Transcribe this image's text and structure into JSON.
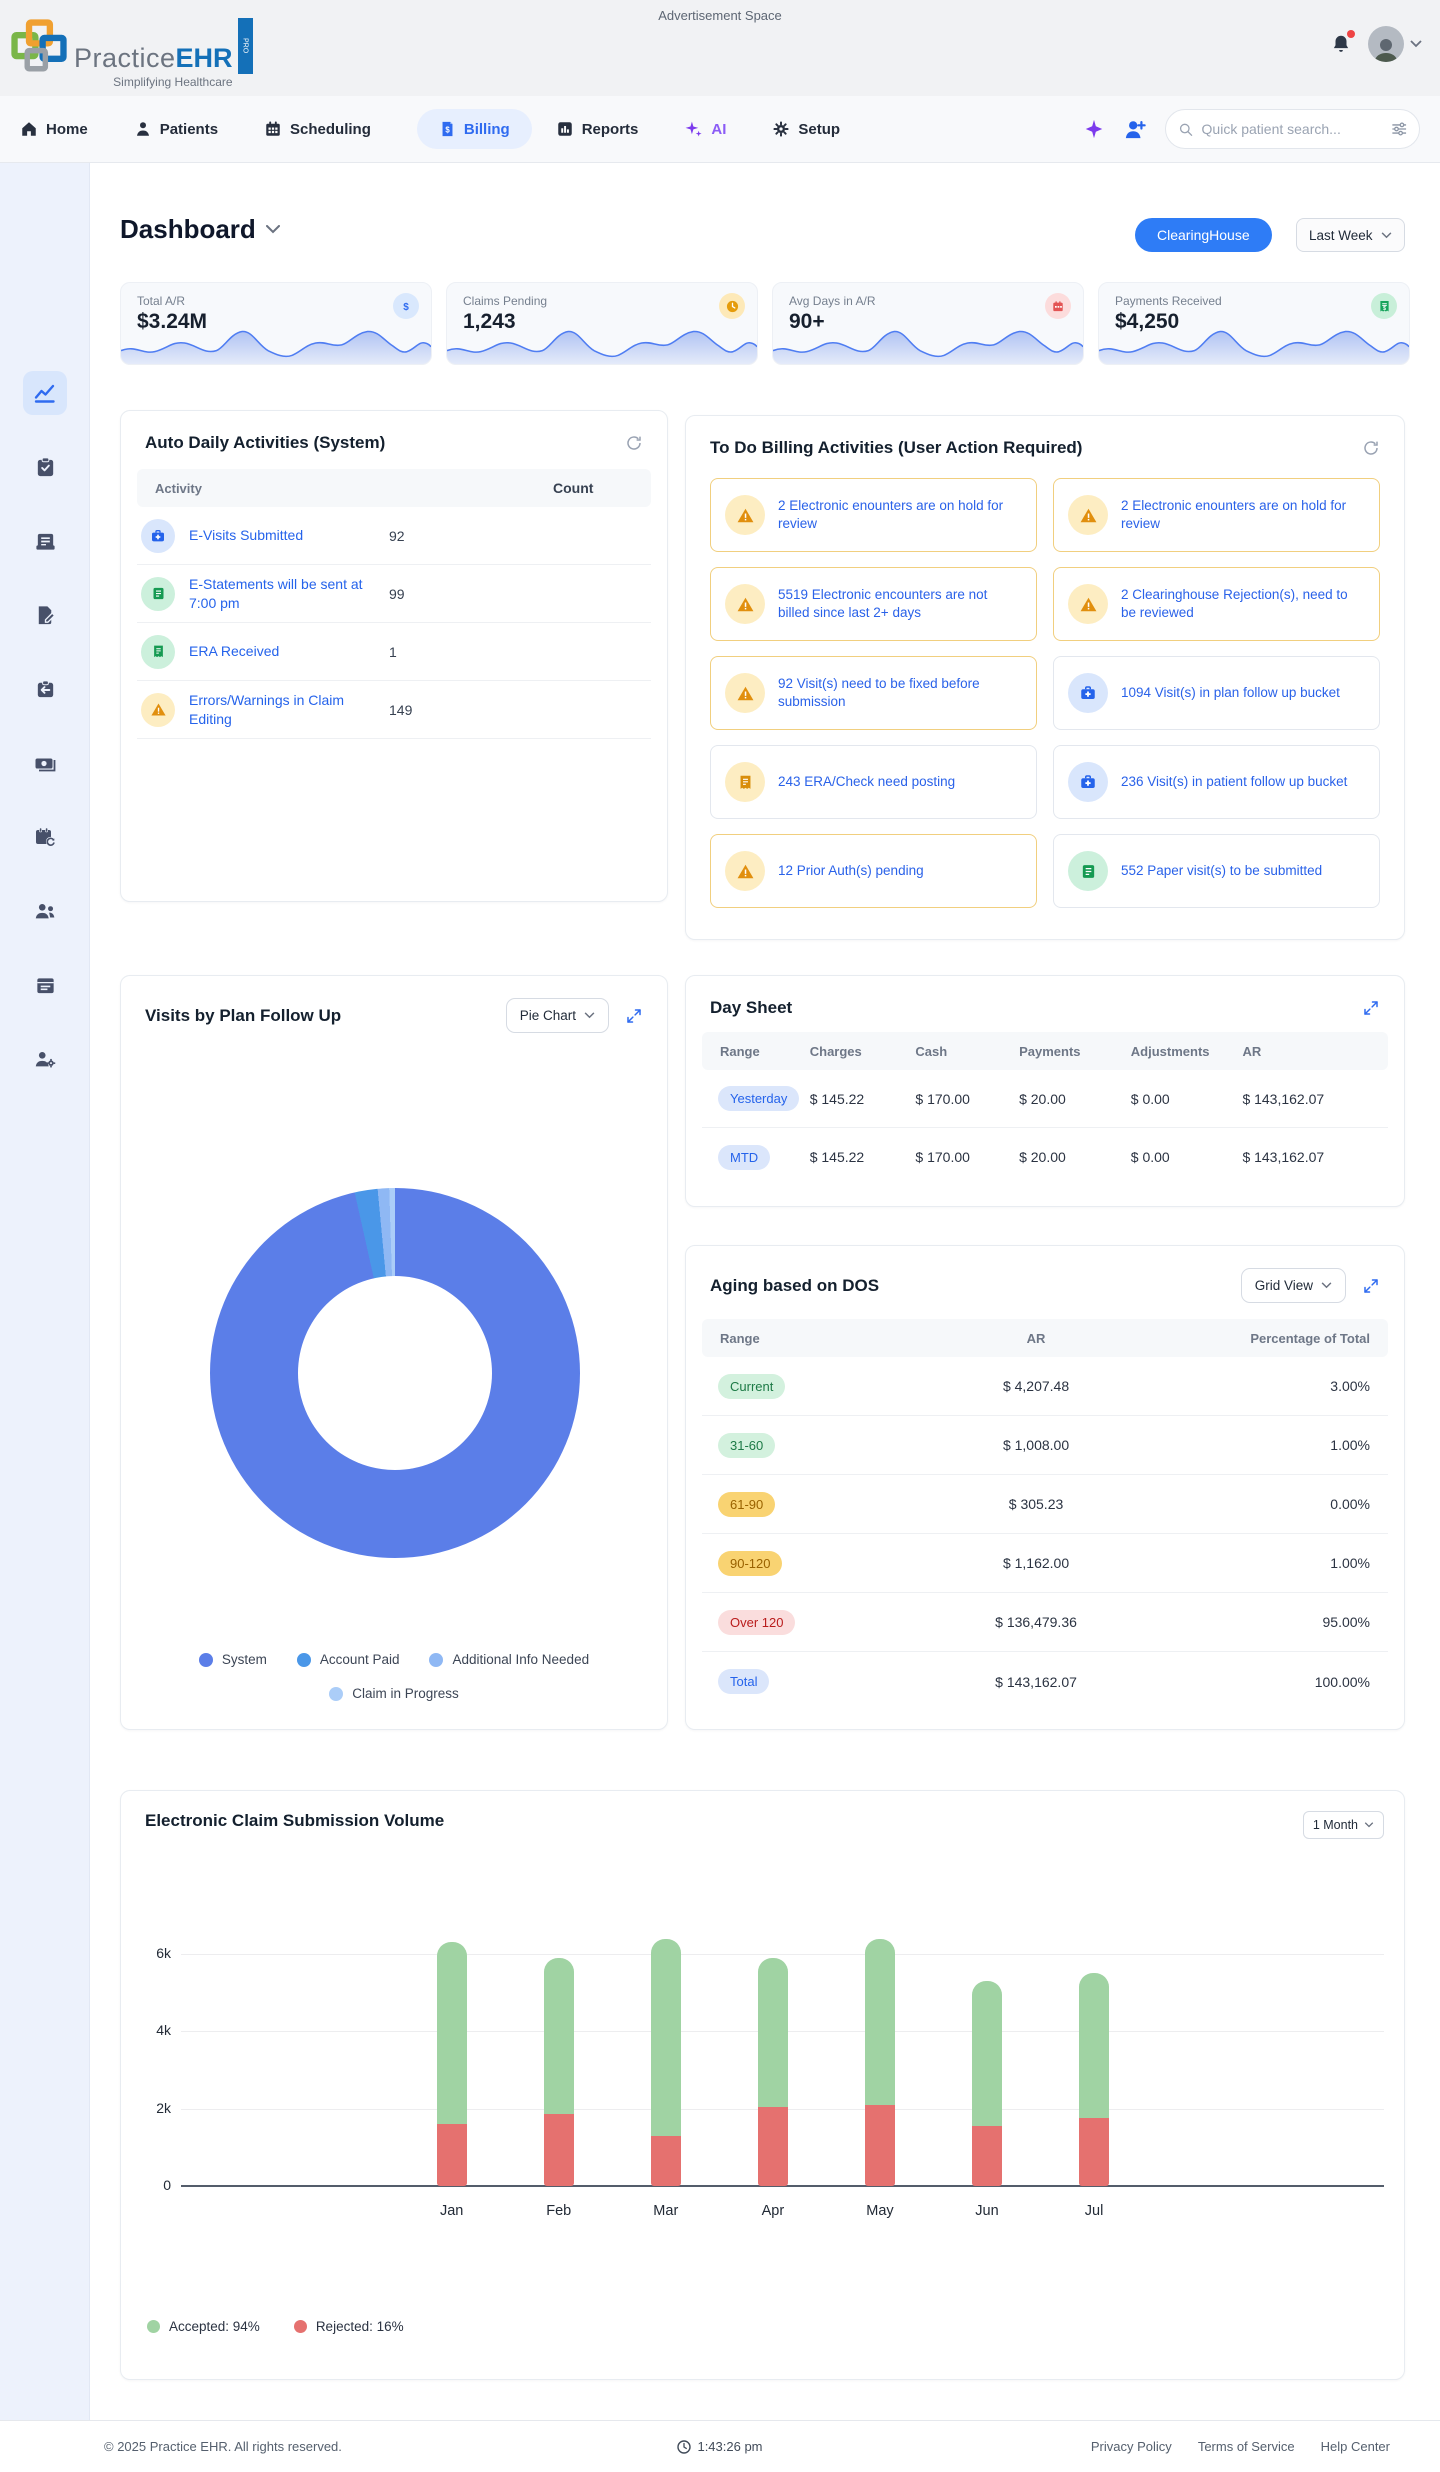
{
  "topbar": {
    "ad_text": "Advertisement Space",
    "brand": {
      "name_a": "Practice",
      "name_b": "EHR",
      "pro": "PRO",
      "tagline": "Simplifying Healthcare"
    }
  },
  "nav": {
    "items": [
      "Home",
      "Patients",
      "Scheduling",
      "Billing",
      "Reports",
      "AI",
      "Setup"
    ],
    "active": "Billing",
    "search_placeholder": "Quick patient search..."
  },
  "sidebar": {
    "active": "dashboard",
    "icons": [
      "chart-line-icon",
      "clipboard-check-icon",
      "receipt-icon",
      "file-edit-icon",
      "clipboard-arrow-icon",
      "cash-icon",
      "calendar-refresh-icon",
      "users-icon",
      "calendar-icon",
      "user-gear-icon"
    ]
  },
  "page": {
    "title": "Dashboard",
    "clearinghouse_button": "ClearingHouse",
    "range_button": "Last Week"
  },
  "stats": [
    {
      "label": "Total A/R",
      "value": "$3.24M",
      "icon": "dollar-icon"
    },
    {
      "label": "Claims Pending",
      "value": "1,243",
      "icon": "clock-icon"
    },
    {
      "label": "Avg Days in A/R",
      "value": "90+",
      "icon": "calendar-icon"
    },
    {
      "label": "Payments Received",
      "value": "$4,250",
      "icon": "receipt-icon"
    }
  ],
  "auto": {
    "title": "Auto Daily Activities (System)",
    "columns": [
      "Activity",
      "Count"
    ],
    "rows": [
      {
        "icon": "medical-bag-icon",
        "label": "E-Visits Submitted",
        "count": "92"
      },
      {
        "icon": "document-icon",
        "label": "E-Statements will be sent at 7:00 pm",
        "count": "99"
      },
      {
        "icon": "receipt-icon",
        "label": "ERA Received",
        "count": "1"
      },
      {
        "icon": "warning-icon",
        "label": "Errors/Warnings in Claim Editing",
        "count": "149"
      }
    ]
  },
  "todo": {
    "title": "To Do Billing Activities (User Action Required)",
    "tiles": [
      {
        "icon": "warning-icon",
        "accent": "yellow",
        "text": "2 Electronic enounters are on hold for review"
      },
      {
        "icon": "warning-icon",
        "accent": "yellow",
        "text": "2 Electronic enounters are on hold for review"
      },
      {
        "icon": "warning-icon",
        "accent": "yellow",
        "text": "5519 Electronic encounters are not billed since last 2+ days"
      },
      {
        "icon": "warning-icon",
        "accent": "yellow",
        "text": "2 Clearinghouse Rejection(s), need to be reviewed"
      },
      {
        "icon": "warning-icon",
        "accent": "yellow",
        "text": "92 Visit(s) need to be fixed before submission"
      },
      {
        "icon": "medical-bag-icon",
        "accent": "gray",
        "text": "1094 Visit(s) in plan follow up bucket"
      },
      {
        "icon": "receipt-icon",
        "accent": "gray",
        "text": "243 ERA/Check need posting"
      },
      {
        "icon": "medical-bag-icon",
        "accent": "gray",
        "text": "236 Visit(s) in patient follow up bucket"
      },
      {
        "icon": "warning-icon",
        "accent": "yellow",
        "text": "12 Prior Auth(s) pending"
      },
      {
        "icon": "document-icon",
        "accent": "gray",
        "text": "552 Paper visit(s) to be submitted"
      }
    ]
  },
  "visits": {
    "title": "Visits by Plan Follow Up",
    "view_button": "Pie Chart",
    "legend": [
      "System",
      "Account Paid",
      "Additional Info Needed",
      "Claim in Progress"
    ]
  },
  "day_sheet": {
    "title": "Day Sheet",
    "columns": [
      "Range",
      "Charges",
      "Cash",
      "Payments",
      "Adjustments",
      "AR"
    ],
    "rows": [
      {
        "range": "Yesterday",
        "charges": "$ 145.22",
        "cash": "$ 170.00",
        "payments": "$ 20.00",
        "adjustments": "$ 0.00",
        "ar": "$ 143,162.07"
      },
      {
        "range": "MTD",
        "charges": "$ 145.22",
        "cash": "$ 170.00",
        "payments": "$ 20.00",
        "adjustments": "$ 0.00",
        "ar": "$ 143,162.07"
      }
    ]
  },
  "aging": {
    "title": "Aging based on DOS",
    "view_button": "Grid View",
    "columns": [
      "Range",
      "AR",
      "Percentage of Total"
    ],
    "rows": [
      {
        "range": "Current",
        "ar": "$ 4,207.48",
        "pct": "3.00%",
        "tone": "green"
      },
      {
        "range": "31-60",
        "ar": "$ 1,008.00",
        "pct": "1.00%",
        "tone": "green"
      },
      {
        "range": "61-90",
        "ar": "$ 305.23",
        "pct": "0.00%",
        "tone": "amber"
      },
      {
        "range": "90-120",
        "ar": "$ 1,162.00",
        "pct": "1.00%",
        "tone": "amber"
      },
      {
        "range": "Over 120",
        "ar": "$ 136,479.36",
        "pct": "95.00%",
        "tone": "red"
      },
      {
        "range": "Total",
        "ar": "$ 143,162.07",
        "pct": "100.00%",
        "tone": "blue"
      }
    ]
  },
  "claims": {
    "title": "Electronic Claim Submission Volume",
    "range_button": "1 Month",
    "legend_accepted": "Accepted: 94%",
    "legend_rejected": "Rejected: 16%"
  },
  "footer": {
    "copyright": "© 2025 Practice EHR. All rights reserved.",
    "time": "1:43:26 pm",
    "links": [
      "Privacy Policy",
      "Terms of Service",
      "Help Center"
    ]
  },
  "colors": {
    "primary_blue": "#2f6bf0",
    "clearinghouse_button": "#2e7cf6",
    "warning_orange": "#e18f0e",
    "success_green": "#159a52",
    "danger_red": "#e35454",
    "spark_line": "#4f7df2"
  },
  "chart_data": [
    {
      "type": "pie",
      "title": "Visits by Plan Follow Up",
      "donut": true,
      "labels": [
        "System",
        "Account Paid",
        "Additional Info Needed",
        "Claim in Progress"
      ],
      "values": [
        96.5,
        2,
        1,
        0.5
      ],
      "colors": [
        "#5b7ee8",
        "#4a97e8",
        "#8fb8f4",
        "#abcdf8"
      ],
      "legend_position": "bottom"
    },
    {
      "type": "bar",
      "stacked": true,
      "title": "Electronic Claim Submission Volume",
      "categories": [
        "Jan",
        "Feb",
        "Mar",
        "Apr",
        "May",
        "Jun",
        "Jul"
      ],
      "series": [
        {
          "name": "Accepted",
          "color": "#a0d3a3",
          "values": [
            4700,
            4050,
            5100,
            3850,
            4300,
            3750,
            3750
          ]
        },
        {
          "name": "Rejected",
          "color": "#e5716f",
          "values": [
            1600,
            1850,
            1300,
            2050,
            2100,
            1550,
            1750
          ]
        }
      ],
      "yticks": [
        "0",
        "2k",
        "4k",
        "6k"
      ],
      "ylim": [
        0,
        6600
      ],
      "grid": true,
      "legend": [
        "Accepted: 94%",
        "Rejected: 16%"
      ]
    }
  ]
}
